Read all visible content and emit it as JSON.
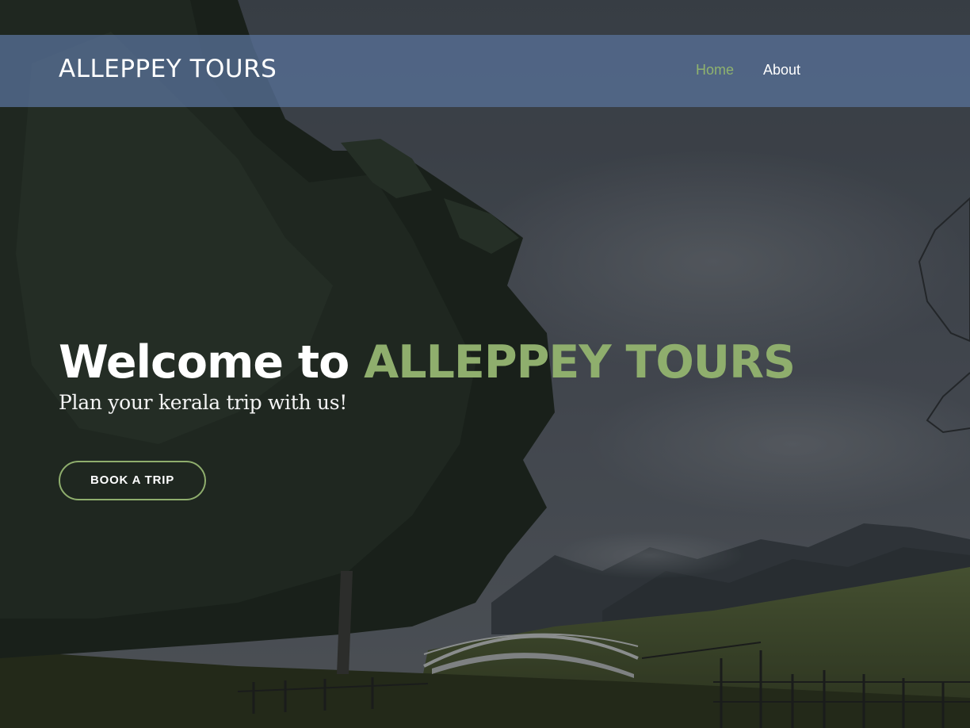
{
  "header": {
    "brand": "ALLEPPEY TOURS",
    "nav": [
      {
        "label": "Home",
        "active": true
      },
      {
        "label": "About",
        "active": false
      }
    ]
  },
  "hero": {
    "title_prefix": "Welcome to ",
    "title_accent": "ALLEPPEY TOURS",
    "subtitle": "Plan your kerala trip with us!",
    "cta_label": "BOOK A TRIP"
  },
  "colors": {
    "accent": "#8fae6d",
    "header_bg": "#577096",
    "text": "#ffffff"
  }
}
